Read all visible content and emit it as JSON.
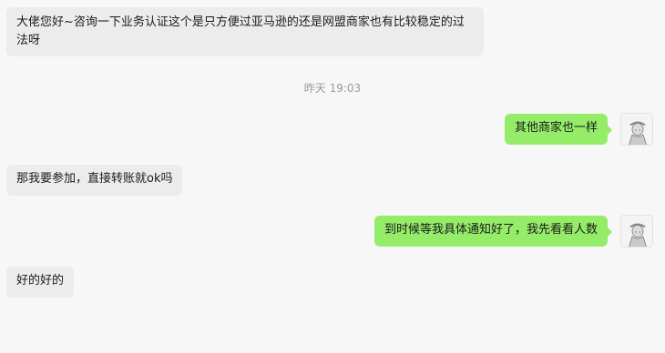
{
  "chat": {
    "timestamp": "昨天 19:03",
    "messages": [
      {
        "direction": "incoming",
        "text": "大佬您好~咨询一下业务认证这个是只方便过亚马逊的还是网盟商家也有比较稳定的过法呀"
      },
      {
        "direction": "outgoing",
        "text": "其他商家也一样"
      },
      {
        "direction": "incoming",
        "text": "那我要参加，直接转账就ok吗"
      },
      {
        "direction": "outgoing",
        "text": "到时候等我具体通知好了，我先看看人数"
      },
      {
        "direction": "incoming",
        "text": "好的好的"
      }
    ]
  },
  "colors": {
    "incoming_bubble": "#ececec",
    "outgoing_bubble": "#95ec69",
    "background": "#f7f7f7",
    "timestamp_text": "#9a9a9a"
  },
  "icons": {
    "avatar": "user-avatar-icon"
  }
}
